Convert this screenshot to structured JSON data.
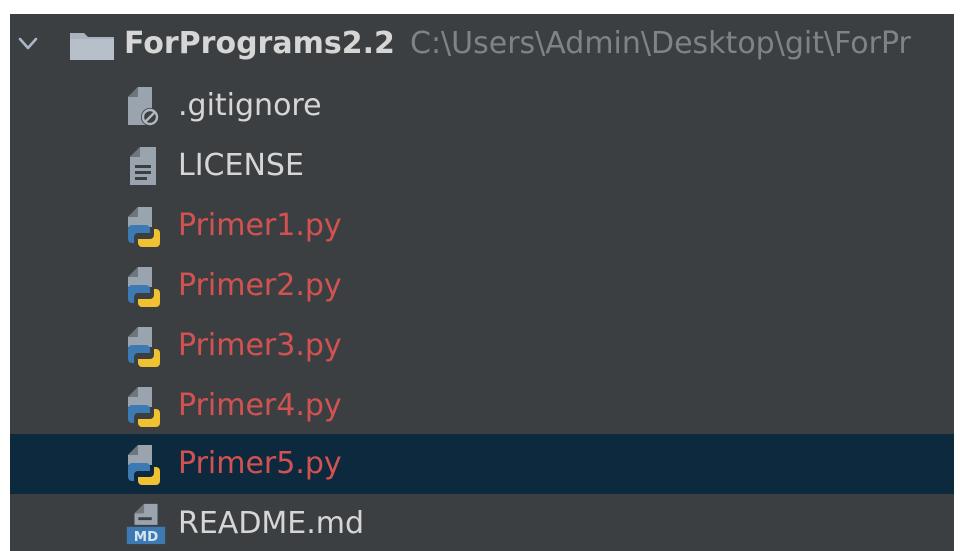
{
  "project": {
    "name": "ForPrograms2.2",
    "path": "C:\\Users\\Admin\\Desktop\\git\\ForPr"
  },
  "files": [
    {
      "name": ".gitignore",
      "icon": "gitignore-file-icon",
      "color": "#d6d6d6",
      "selected": false
    },
    {
      "name": "LICENSE",
      "icon": "text-file-icon",
      "color": "#d6d6d6",
      "selected": false
    },
    {
      "name": "Primer1.py",
      "icon": "python-file-icon",
      "color": "#d25252",
      "selected": false
    },
    {
      "name": "Primer2.py",
      "icon": "python-file-icon",
      "color": "#d25252",
      "selected": false
    },
    {
      "name": "Primer3.py",
      "icon": "python-file-icon",
      "color": "#d25252",
      "selected": false
    },
    {
      "name": "Primer4.py",
      "icon": "python-file-icon",
      "color": "#d25252",
      "selected": false
    },
    {
      "name": "Primer5.py",
      "icon": "python-file-icon",
      "color": "#d25252",
      "selected": true
    },
    {
      "name": "README.md",
      "icon": "markdown-file-icon",
      "color": "#d6d6d6",
      "selected": false
    }
  ],
  "colors": {
    "panel_bg": "#3c3f41",
    "selected_bg": "#0d293e",
    "default_text": "#d6d6d6",
    "untracked_text": "#d25252",
    "path_text": "#7f8387"
  }
}
